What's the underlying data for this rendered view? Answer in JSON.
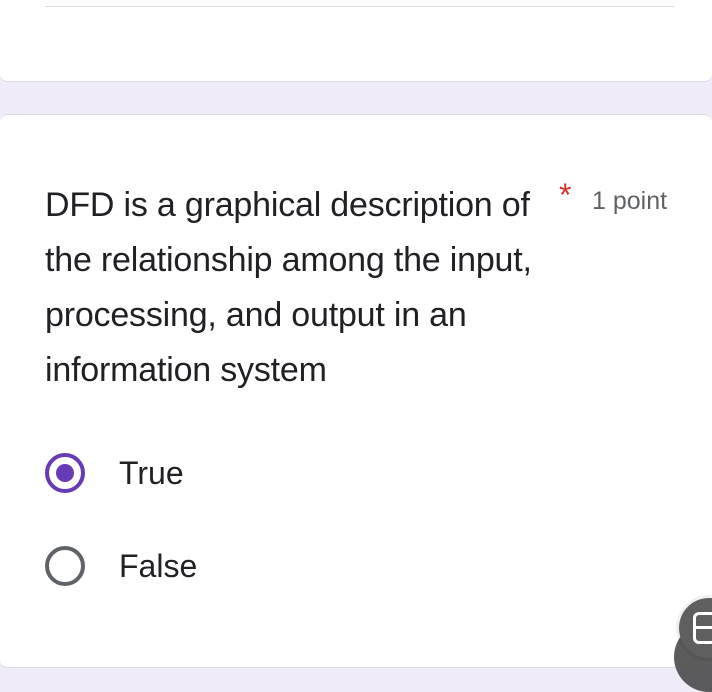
{
  "question": {
    "text": "DFD is a graphical description of the relationship among the input, processing, and output in an information system",
    "required_marker": "*",
    "points": "1 point"
  },
  "options": [
    {
      "label": "True",
      "selected": true
    },
    {
      "label": "False",
      "selected": false
    }
  ],
  "colors": {
    "accent": "#673ab7",
    "required": "#d93025",
    "background": "#f0ebf8",
    "text": "#202124",
    "muted": "#5f6368"
  },
  "icons": {
    "floating_button": "screen-capture-icon"
  }
}
